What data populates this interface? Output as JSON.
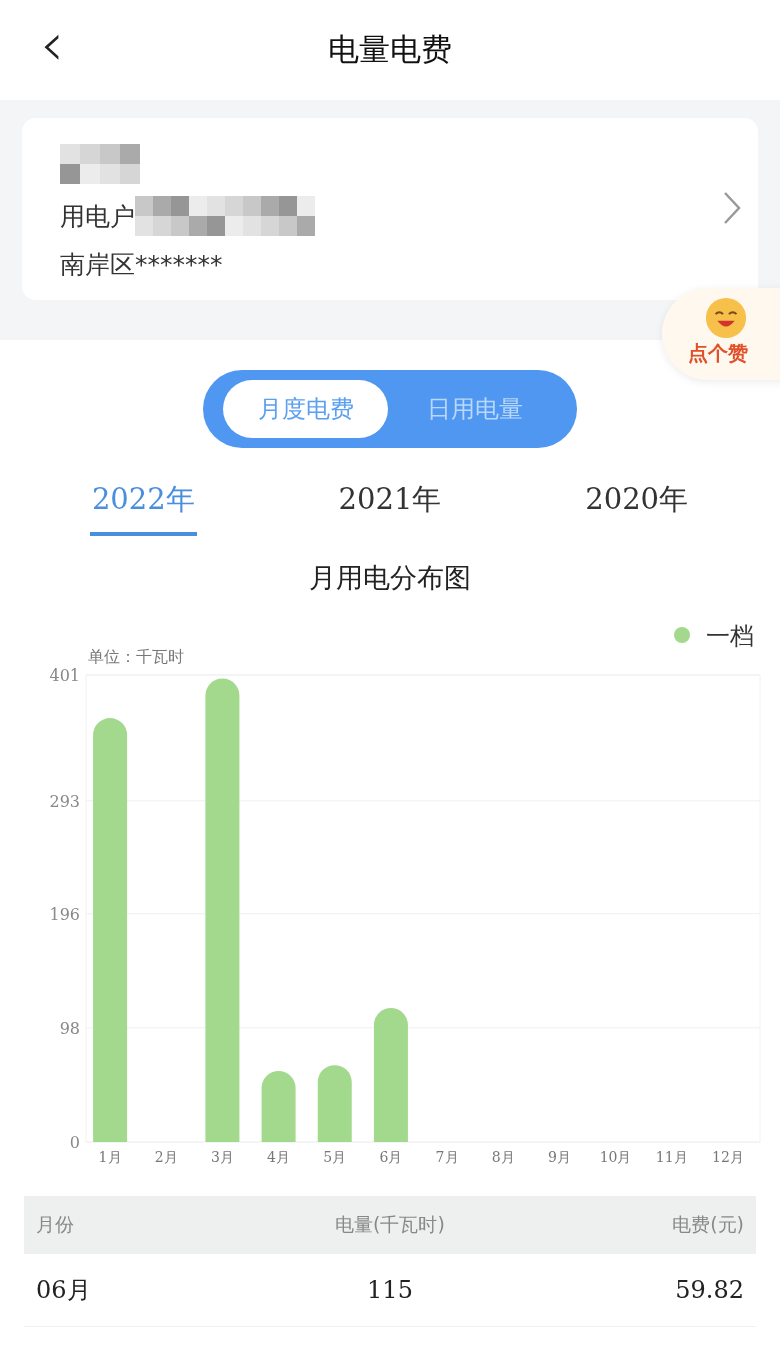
{
  "header": {
    "back_icon": "‹",
    "title": "电量电费"
  },
  "account": {
    "line_2_label": "用电户",
    "line_3": "南岸区*******"
  },
  "like_badge": {
    "label": "点个赞"
  },
  "mode_toggle": [
    {
      "label": "月度电费",
      "selected": true
    },
    {
      "label": "日用电量",
      "selected": false
    }
  ],
  "year_tabs": [
    {
      "label": "2022年",
      "selected": true
    },
    {
      "label": "2021年",
      "selected": false
    },
    {
      "label": "2020年",
      "selected": false
    }
  ],
  "chart": {
    "title": "月用电分布图",
    "unit": "单位：千瓦时",
    "chart_data": {
      "type": "bar",
      "categories": [
        "1月",
        "2月",
        "3月",
        "4月",
        "5月",
        "6月",
        "7月",
        "8月",
        "9月",
        "10月",
        "11月",
        "12月"
      ],
      "series": [
        {
          "name": "一档",
          "color": "#a3d98d",
          "values": [
            364,
            null,
            398,
            61,
            66,
            115,
            null,
            null,
            null,
            null,
            null,
            null
          ]
        }
      ],
      "grid": true,
      "ylim": [
        0,
        401
      ],
      "yticks": [
        0,
        98,
        196,
        293,
        401
      ]
    }
  },
  "table": {
    "columns": [
      "月份",
      "电量(千瓦时)",
      "电费(元)"
    ],
    "rows": [
      [
        "06月",
        "115",
        "59.82"
      ]
    ]
  }
}
